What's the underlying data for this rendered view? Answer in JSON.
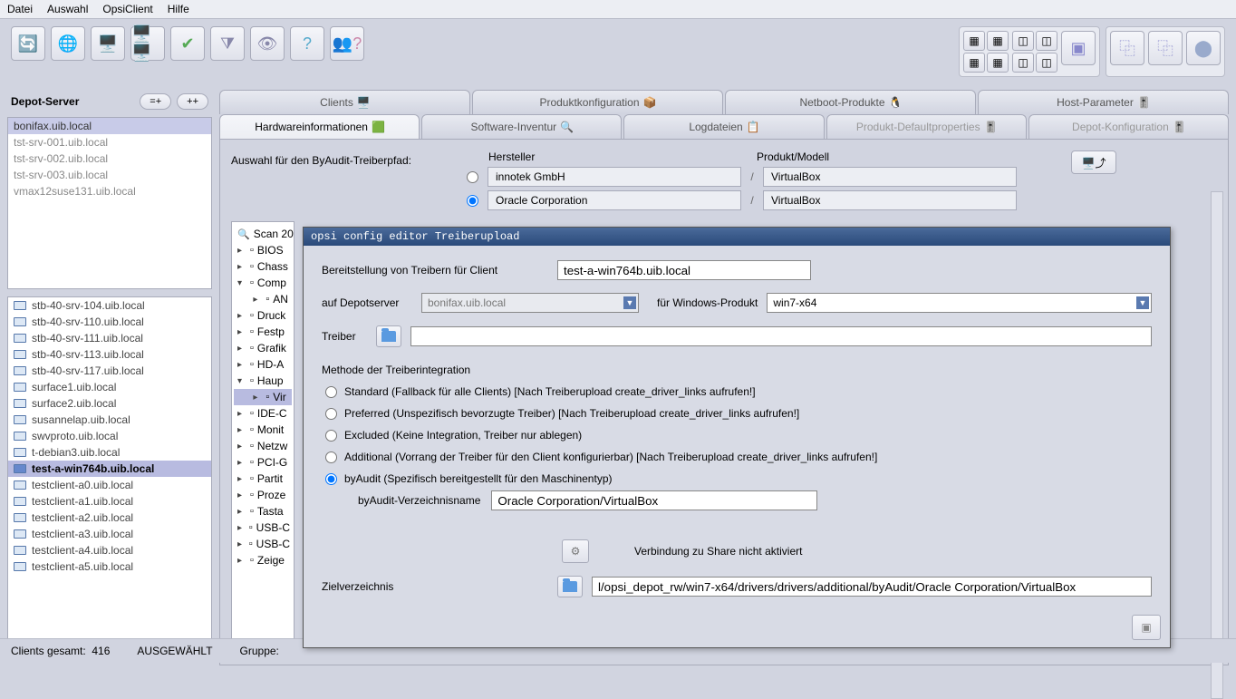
{
  "menubar": {
    "file": "Datei",
    "selection": "Auswahl",
    "opsiclient": "OpsiClient",
    "help": "Hilfe"
  },
  "depot": {
    "title": "Depot-Server",
    "btn_assign": "=+",
    "btn_add": "++",
    "items": [
      "bonifax.uib.local",
      "tst-srv-001.uib.local",
      "tst-srv-002.uib.local",
      "tst-srv-003.uib.local",
      "vmax12suse131.uib.local"
    ]
  },
  "clients": [
    "stb-40-srv-104.uib.local",
    "stb-40-srv-110.uib.local",
    "stb-40-srv-111.uib.local",
    "stb-40-srv-113.uib.local",
    "stb-40-srv-117.uib.local",
    "surface1.uib.local",
    "surface2.uib.local",
    "susannelap.uib.local",
    "swvproto.uib.local",
    "t-debian3.uib.local",
    "test-a-win764b.uib.local",
    "testclient-a0.uib.local",
    "testclient-a1.uib.local",
    "testclient-a2.uib.local",
    "testclient-a3.uib.local",
    "testclient-a4.uib.local",
    "testclient-a5.uib.local"
  ],
  "selected_client": "test-a-win764b.uib.local",
  "tabs_top": {
    "clients": "Clients",
    "prodkonf": "Produktkonfiguration",
    "netboot": "Netboot-Produkte",
    "hostparam": "Host-Parameter"
  },
  "tabs_sub": {
    "hwinfo": "Hardwareinformationen",
    "swinv": "Software-Inventur",
    "logs": "Logdateien",
    "proddef": "Produkt-Defaultproperties",
    "depotconf": "Depot-Konfiguration"
  },
  "byaudit": {
    "label": "Auswahl für den ByAudit-Treiberpfad:",
    "head_vendor": "Hersteller",
    "head_model": "Produkt/Modell",
    "rows": [
      {
        "vendor": "innotek GmbH",
        "model": "VirtualBox"
      },
      {
        "vendor": "Oracle Corporation",
        "model": "VirtualBox"
      }
    ]
  },
  "tree": {
    "root": "Scan 20",
    "items": [
      "BIOS",
      "Chass",
      "Comp",
      "AN",
      "Druck",
      "Festp",
      "Grafik",
      "HD-A",
      "Haup",
      "Vir",
      "IDE-C",
      "Monit",
      "Netzw",
      "PCI-G",
      "Partit",
      "Proze",
      "Tasta",
      "USB-C",
      "USB-C",
      "Zeige"
    ]
  },
  "status": {
    "total_label": "Clients gesamt:",
    "total": "416",
    "sel_label": "AUSGEWÄHLT",
    "group_label": "Gruppe:"
  },
  "modal": {
    "title": "opsi config editor Treiberupload",
    "provide_label": "Bereitstellung von Treibern für Client",
    "client": "test-a-win764b.uib.local",
    "depot_label": "auf Depotserver",
    "depot_value": "bonifax.uib.local",
    "winprod_label": "für Windows-Produkt",
    "winprod_value": "win7-x64",
    "driver_label": "Treiber",
    "driver_value": "",
    "method_title": "Methode der Treiberintegration",
    "opts": {
      "standard": "Standard (Fallback für alle Clients) [Nach Treiberupload create_driver_links aufrufen!]",
      "preferred": "Preferred (Unspezifisch bevorzugte Treiber) [Nach Treiberupload create_driver_links aufrufen!]",
      "excluded": "Excluded (Keine Integration, Treiber nur ablegen)",
      "additional": "Additional (Vorrang der Treiber für den Client konfigurierbar) [Nach Treiberupload create_driver_links aufrufen!]",
      "byaudit": "byAudit (Spezifisch bereitgestellt für den Maschinentyp)"
    },
    "byaudit_dir_label": "byAudit-Verzeichnisname",
    "byaudit_dir": "Oracle Corporation/VirtualBox",
    "share_msg": "Verbindung zu Share nicht aktiviert",
    "target_label": "Zielverzeichnis",
    "target_value": "l/opsi_depot_rw/win7-x64/drivers/drivers/additional/byAudit/Oracle Corporation/VirtualBox"
  }
}
